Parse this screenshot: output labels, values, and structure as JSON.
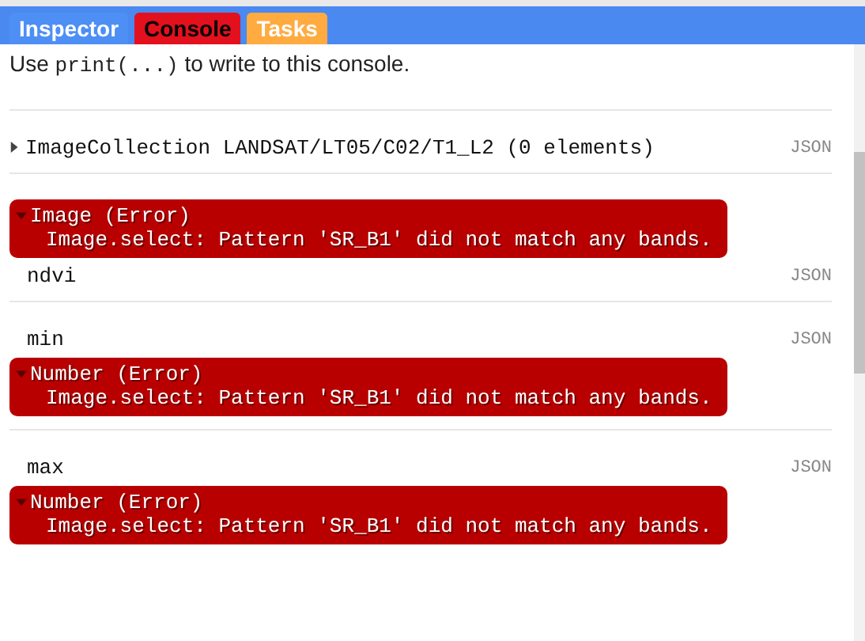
{
  "tabs": [
    {
      "label": "Inspector",
      "selected": false,
      "color": "#4d8ff5"
    },
    {
      "label": "Console",
      "selected": true,
      "color": "#e3101d"
    },
    {
      "label": "Tasks",
      "selected": false,
      "color": "#ffab40"
    }
  ],
  "intro": {
    "before": "Use",
    "code": "print(...)",
    "after": "to write to this console."
  },
  "groups": [
    {
      "items": [
        {
          "kind": "object",
          "text": "ImageCollection LANDSAT/LT05/C02/T1_L2 (0 elements)",
          "expanded": false,
          "link": "JSON"
        }
      ]
    },
    {
      "items": [
        {
          "kind": "error",
          "title": "Image (Error)",
          "message": "Image.select: Pattern 'SR_B1' did not match any bands.",
          "expanded": true
        },
        {
          "kind": "label",
          "text": "ndvi",
          "link": "JSON"
        }
      ]
    },
    {
      "items": [
        {
          "kind": "label",
          "text": "min",
          "link": "JSON"
        },
        {
          "kind": "error",
          "title": "Number (Error)",
          "message": "Image.select: Pattern 'SR_B1' did not match any bands.",
          "expanded": true
        }
      ]
    },
    {
      "items": [
        {
          "kind": "label",
          "text": "max",
          "link": "JSON"
        },
        {
          "kind": "error",
          "title": "Number (Error)",
          "message": "Image.select: Pattern 'SR_B1' did not match any bands.",
          "expanded": true
        }
      ]
    }
  ]
}
